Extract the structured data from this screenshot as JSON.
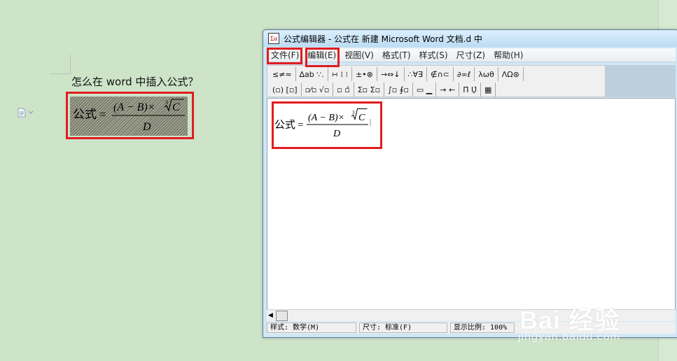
{
  "document": {
    "question": "怎么在 word 中插入公式？",
    "formula": {
      "lhs": "公式",
      "equals": "=",
      "numerator_part1": "(A − B)×",
      "root_index": "3",
      "root_radicand": "C",
      "denominator": "D"
    }
  },
  "window": {
    "title": "公式编辑器 - 公式在 新建 Microsoft Word 文档.d 中",
    "app_icon_label": "Σα",
    "menu": [
      {
        "label": "文件(F)"
      },
      {
        "label": "编辑(E)"
      },
      {
        "label": "视图(V)"
      },
      {
        "label": "格式(T)"
      },
      {
        "label": "样式(S)"
      },
      {
        "label": "尺寸(Z)"
      },
      {
        "label": "帮助(H)"
      }
    ],
    "toolbar_row1": [
      {
        "label": "≤≠≈",
        "icon": "relations-icon"
      },
      {
        "label": "∆ab ∵.",
        "icon": "spaces-icon"
      },
      {
        "label": "∺ ⁞ ⁝",
        "icon": "embellishments-icon"
      },
      {
        "label": "±•⊗",
        "icon": "operators-icon"
      },
      {
        "label": "→⇔↓",
        "icon": "arrows-icon"
      },
      {
        "label": "∴∀∃",
        "icon": "logic-icon"
      },
      {
        "label": "∉∩⊂",
        "icon": "set-theory-icon"
      },
      {
        "label": "∂∞ℓ",
        "icon": "misc-symbols-icon"
      },
      {
        "label": "λωθ",
        "icon": "greek-lower-icon"
      },
      {
        "label": "ΛΩ⊛",
        "icon": "greek-upper-icon"
      }
    ],
    "toolbar_row2": [
      {
        "label": "(▫) [▫]",
        "icon": "fences-icon"
      },
      {
        "label": "▫⁄▫ √▫",
        "icon": "fractions-radicals-icon"
      },
      {
        "label": "▫ ▫̂",
        "icon": "scripts-icon"
      },
      {
        "label": "Σ▫ Σ▫",
        "icon": "summation-icon"
      },
      {
        "label": "∫▫ ∮▫",
        "icon": "integrals-icon"
      },
      {
        "label": "▭ ▁",
        "icon": "bars-icon"
      },
      {
        "label": "→ ←",
        "icon": "labeled-arrows-icon"
      },
      {
        "label": "Π̄ Ụ̇",
        "icon": "products-icon"
      },
      {
        "label": "▦",
        "icon": "matrix-icon"
      }
    ],
    "editor_formula": {
      "lhs": "公式",
      "equals": "=",
      "numerator_part1": "(A − B)×",
      "root_index": "3",
      "root_radicand": "C",
      "denominator": "D"
    },
    "status": {
      "style": "样式: 数学(M)",
      "size": "尺寸: 标准(F)",
      "zoom": "显示比例: 100%"
    }
  },
  "watermark": {
    "brand": "Bai  经验",
    "domain": "jingyan.baidu.com"
  },
  "colors": {
    "page_bg": "#cde4c9",
    "highlight_red": "#e21c20",
    "title_bar": "#cfe7f6"
  }
}
